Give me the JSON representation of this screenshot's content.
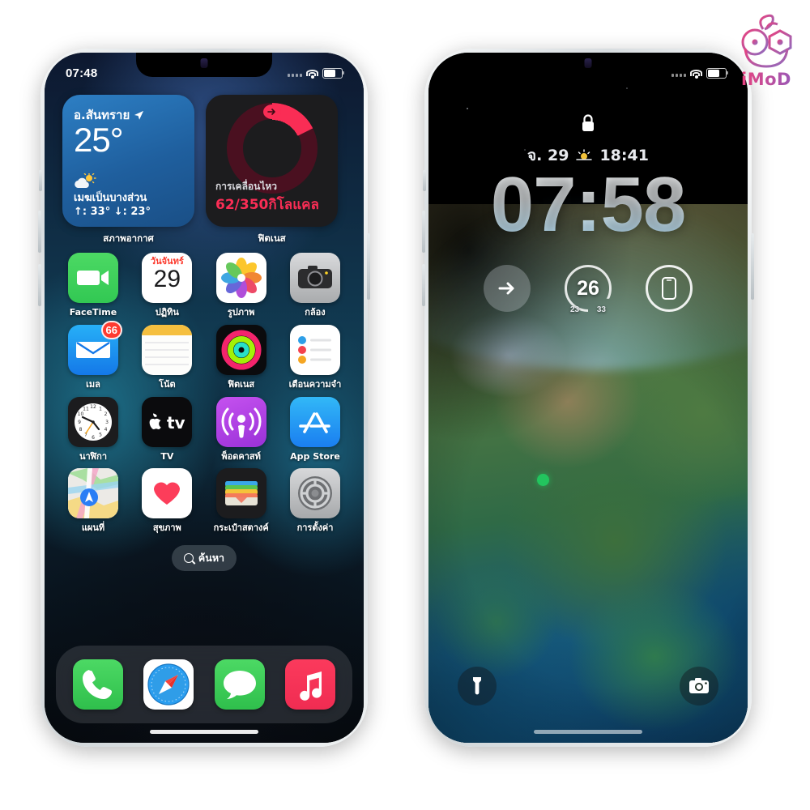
{
  "watermark": {
    "text": "iMoD",
    "icon": "robot-face-logo"
  },
  "phones": {
    "left": {
      "name": "iphone-home-screen",
      "status_bar": {
        "time": "07:48",
        "wifi_icon": "wifi-icon",
        "battery_icon": "battery-icon",
        "cellular_icon": "cellular-signal-icon"
      },
      "widgets": [
        {
          "id": "weather-widget",
          "label": "สภาพอากาศ",
          "location": "อ.สันทราย",
          "location_icon": "location-arrow-icon",
          "temperature": "25°",
          "condition": "เมฆเป็นบางส่วน",
          "condition_icon": "sun-behind-cloud-icon",
          "high_low": "↑: 33° ↓: 23°"
        },
        {
          "id": "fitness-widget",
          "label": "ฟิตเนส",
          "ring_label": "การเคลื่อนไหว",
          "ring_value": "62/350กิโลแคล",
          "ring_icon": "arrow-right-icon",
          "ring_color": "#fa2d55"
        }
      ],
      "app_rows": [
        [
          {
            "name": "facetime",
            "label": "FaceTime",
            "icon": "facetime-video-icon"
          },
          {
            "name": "calendar",
            "label": "ปฏิทิน",
            "icon": "calendar-icon",
            "weekday": "วันจันทร์",
            "day": "29"
          },
          {
            "name": "photos",
            "label": "รูปภาพ",
            "icon": "photos-pinwheel-icon"
          },
          {
            "name": "camera",
            "label": "กล้อง",
            "icon": "camera-icon"
          }
        ],
        [
          {
            "name": "mail",
            "label": "เมล",
            "icon": "mail-envelope-icon",
            "badge": "66"
          },
          {
            "name": "notes",
            "label": "โน้ต",
            "icon": "notes-icon"
          },
          {
            "name": "fitness",
            "label": "ฟิตเนส",
            "icon": "activity-rings-icon"
          },
          {
            "name": "reminders",
            "label": "เตือนความจำ",
            "icon": "reminders-list-icon"
          }
        ],
        [
          {
            "name": "clock",
            "label": "นาฬิกา",
            "icon": "analog-clock-icon"
          },
          {
            "name": "tv",
            "label": "TV",
            "icon": "apple-tv-icon"
          },
          {
            "name": "podcasts",
            "label": "พ็อดคาสท์",
            "icon": "podcasts-icon"
          },
          {
            "name": "appstore",
            "label": "App Store",
            "icon": "app-store-icon"
          }
        ],
        [
          {
            "name": "maps",
            "label": "แผนที่",
            "icon": "maps-icon"
          },
          {
            "name": "health",
            "label": "สุขภาพ",
            "icon": "health-heart-icon"
          },
          {
            "name": "wallet",
            "label": "กระเป๋าสตางค์",
            "icon": "wallet-cards-icon"
          },
          {
            "name": "settings",
            "label": "การตั้งค่า",
            "icon": "settings-gear-icon"
          }
        ]
      ],
      "search": {
        "label": "ค้นหา",
        "icon": "search-icon"
      },
      "dock": [
        {
          "name": "phone",
          "icon": "phone-handset-icon"
        },
        {
          "name": "safari",
          "icon": "safari-compass-icon"
        },
        {
          "name": "messages",
          "icon": "messages-bubble-icon"
        },
        {
          "name": "music",
          "icon": "music-note-icon"
        }
      ]
    },
    "right": {
      "name": "iphone-lock-screen",
      "status_bar": {
        "wifi_icon": "wifi-icon",
        "battery_icon": "battery-icon",
        "cellular_icon": "cellular-signal-icon"
      },
      "lock_icon": "padlock-closed-icon",
      "date": "จ. 29",
      "date_icon": "sunrise-icon",
      "date_time": "18:41",
      "time": "07:58",
      "widgets": [
        {
          "name": "shortcut-arrow-widget",
          "icon": "arrow-right-circle-icon"
        },
        {
          "name": "weather-gauge-widget",
          "icon": "temperature-gauge-icon",
          "value": "26",
          "low": "23",
          "high": "33"
        },
        {
          "name": "device-battery-widget",
          "icon": "iphone-device-icon"
        }
      ],
      "bottom": [
        {
          "name": "flashlight-button",
          "icon": "flashlight-icon"
        },
        {
          "name": "camera-button",
          "icon": "camera-icon"
        }
      ],
      "wallpaper": {
        "name": "earth-satellite-wallpaper",
        "marker": "location-dot"
      }
    }
  }
}
